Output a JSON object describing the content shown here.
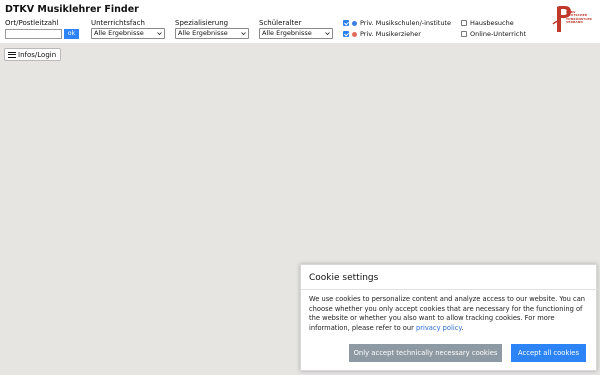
{
  "app": {
    "title": "DTKV Musiklehrer Finder"
  },
  "filters": {
    "location": {
      "label": "Ort/Postleitzahl",
      "value": "",
      "placeholder": "",
      "ok_label": "ok"
    },
    "subject": {
      "label": "Unterrichtsfach",
      "selected": "Alle Ergebnisse"
    },
    "specialization": {
      "label": "Spezialisierung",
      "selected": "Alle Ergebnisse"
    },
    "student_age": {
      "label": "Schüleralter",
      "selected": "Alle Ergebnisse"
    },
    "checkboxes": [
      {
        "label": "Priv. Musikschulen/-institute",
        "checked": true,
        "dot_color": "#3d7ee8"
      },
      {
        "label": "Priv. Musikerzieher",
        "checked": true,
        "dot_color": "#e36b5d"
      },
      {
        "label": "Hausbesuche",
        "checked": false
      },
      {
        "label": "Online-Unterricht",
        "checked": false
      }
    ]
  },
  "logo": {
    "text_lines": [
      "DTKV",
      "DEUTSCHER",
      "TONKÜNSTLER",
      "VERBAND"
    ],
    "color": "#c0392b"
  },
  "map": {
    "background": "#e6e5e2",
    "infos_button_label": "Infos/Login",
    "infos_icon": "menu-icon"
  },
  "cookie": {
    "title": "Cookie settings",
    "text": "We use cookies to personalize content and analyze access to our website. You can choose whether you only accept cookies that are necessary for the functioning of the website or whether you also want to allow tracking cookies. For more information, please refer to our ",
    "link_text": "privacy policy",
    "text_end": ".",
    "necessary_button": "Only accept technically necessary cookies",
    "accept_button": "Accept all cookies",
    "accept_color": "#2d84f6",
    "necessary_color": "#8e9aa3"
  }
}
